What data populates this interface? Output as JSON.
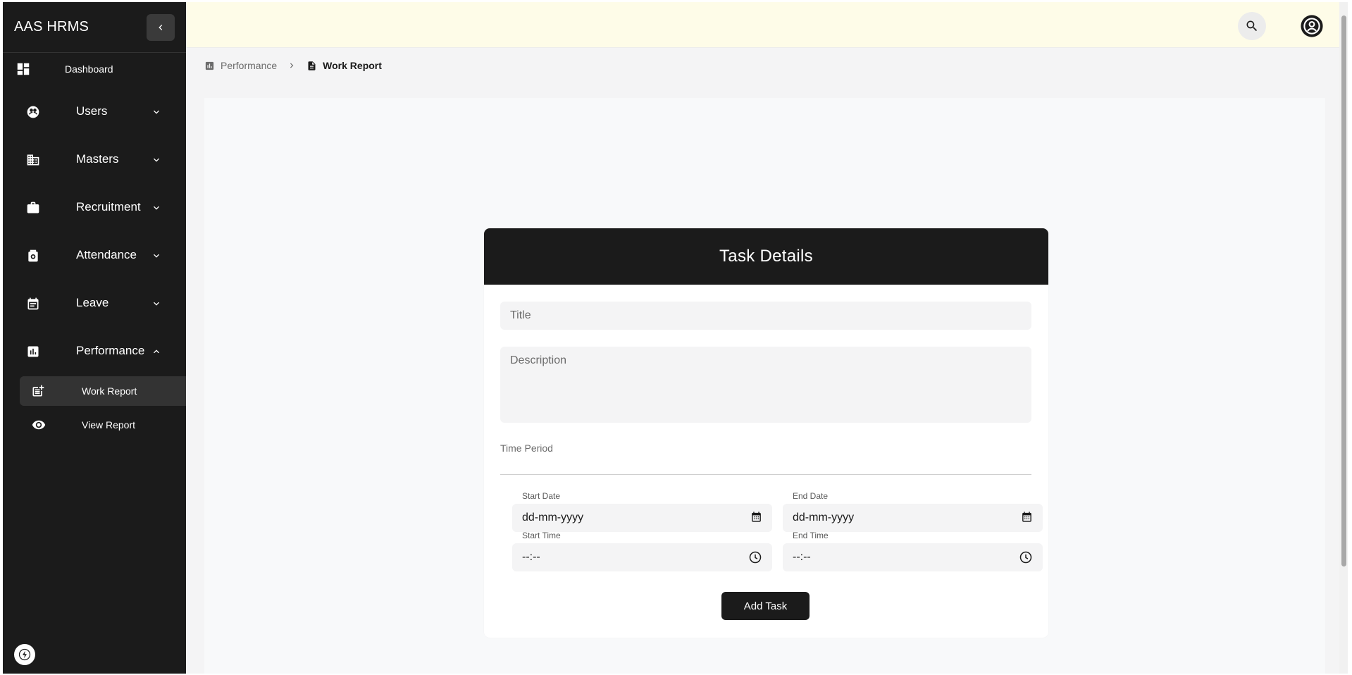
{
  "app": {
    "title": "AAS HRMS"
  },
  "sidebar": {
    "dashboard": {
      "label": "Dashboard",
      "icon": "dashboard-icon"
    },
    "items": [
      {
        "label": "Users",
        "icon": "users-icon",
        "expanded": false
      },
      {
        "label": "Masters",
        "icon": "building-icon",
        "expanded": false
      },
      {
        "label": "Recruitment",
        "icon": "briefcase-icon",
        "expanded": false
      },
      {
        "label": "Attendance",
        "icon": "attendance-icon",
        "expanded": false
      },
      {
        "label": "Leave",
        "icon": "calendar-icon",
        "expanded": false
      },
      {
        "label": "Performance",
        "icon": "chart-icon",
        "expanded": true
      }
    ],
    "sub_items": [
      {
        "label": "Work Report",
        "icon": "post-add-icon",
        "active": true
      },
      {
        "label": "View Report",
        "icon": "eye-icon",
        "active": false
      }
    ]
  },
  "breadcrumb": {
    "parent": "Performance",
    "current": "Work Report"
  },
  "form": {
    "header": "Task Details",
    "title_placeholder": "Title",
    "description_placeholder": "Description",
    "time_period_label": "Time Period",
    "start_date": {
      "label": "Start Date",
      "value": "dd-mm-yyyy"
    },
    "end_date": {
      "label": "End Date",
      "value": "dd-mm-yyyy"
    },
    "start_time": {
      "label": "Start Time",
      "value": "--:--"
    },
    "end_time": {
      "label": "End Time",
      "value": "--:--"
    },
    "submit_label": "Add Task"
  },
  "colors": {
    "sidebar_bg": "#1b1b1b",
    "topbar_bg": "#fefce8",
    "accent": "#1b1b1b"
  }
}
